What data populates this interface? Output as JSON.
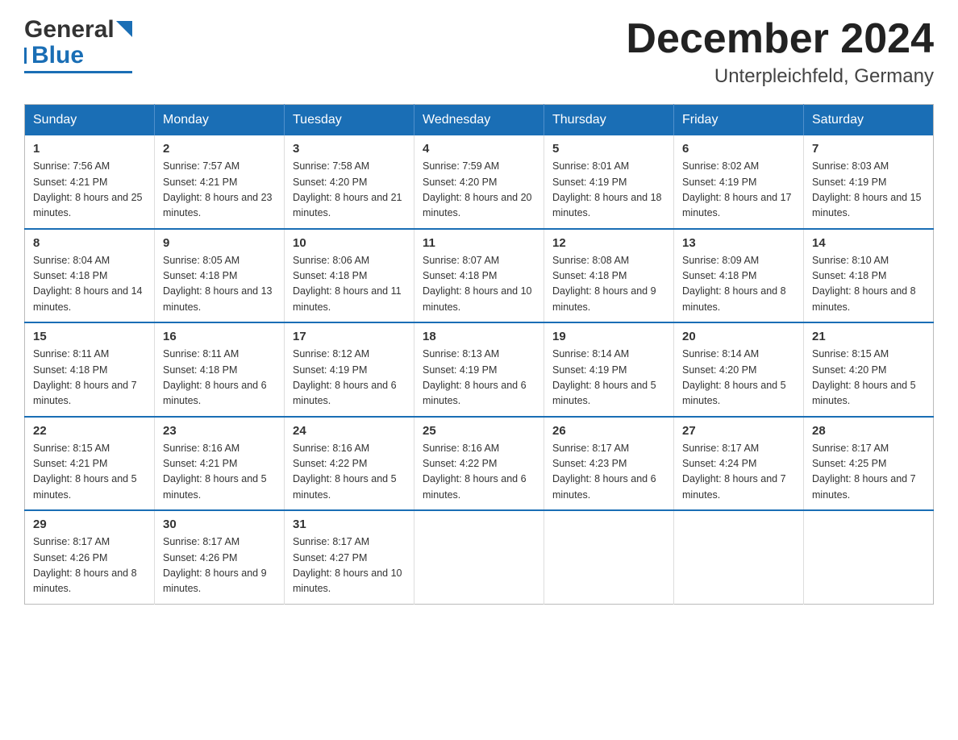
{
  "header": {
    "logo_text_general": "General",
    "logo_text_blue": "Blue",
    "month_title": "December 2024",
    "location": "Unterpleichfeld, Germany"
  },
  "weekdays": [
    "Sunday",
    "Monday",
    "Tuesday",
    "Wednesday",
    "Thursday",
    "Friday",
    "Saturday"
  ],
  "weeks": [
    [
      {
        "day": "1",
        "sunrise": "7:56 AM",
        "sunset": "4:21 PM",
        "daylight": "8 hours and 25 minutes."
      },
      {
        "day": "2",
        "sunrise": "7:57 AM",
        "sunset": "4:21 PM",
        "daylight": "8 hours and 23 minutes."
      },
      {
        "day": "3",
        "sunrise": "7:58 AM",
        "sunset": "4:20 PM",
        "daylight": "8 hours and 21 minutes."
      },
      {
        "day": "4",
        "sunrise": "7:59 AM",
        "sunset": "4:20 PM",
        "daylight": "8 hours and 20 minutes."
      },
      {
        "day": "5",
        "sunrise": "8:01 AM",
        "sunset": "4:19 PM",
        "daylight": "8 hours and 18 minutes."
      },
      {
        "day": "6",
        "sunrise": "8:02 AM",
        "sunset": "4:19 PM",
        "daylight": "8 hours and 17 minutes."
      },
      {
        "day": "7",
        "sunrise": "8:03 AM",
        "sunset": "4:19 PM",
        "daylight": "8 hours and 15 minutes."
      }
    ],
    [
      {
        "day": "8",
        "sunrise": "8:04 AM",
        "sunset": "4:18 PM",
        "daylight": "8 hours and 14 minutes."
      },
      {
        "day": "9",
        "sunrise": "8:05 AM",
        "sunset": "4:18 PM",
        "daylight": "8 hours and 13 minutes."
      },
      {
        "day": "10",
        "sunrise": "8:06 AM",
        "sunset": "4:18 PM",
        "daylight": "8 hours and 11 minutes."
      },
      {
        "day": "11",
        "sunrise": "8:07 AM",
        "sunset": "4:18 PM",
        "daylight": "8 hours and 10 minutes."
      },
      {
        "day": "12",
        "sunrise": "8:08 AM",
        "sunset": "4:18 PM",
        "daylight": "8 hours and 9 minutes."
      },
      {
        "day": "13",
        "sunrise": "8:09 AM",
        "sunset": "4:18 PM",
        "daylight": "8 hours and 8 minutes."
      },
      {
        "day": "14",
        "sunrise": "8:10 AM",
        "sunset": "4:18 PM",
        "daylight": "8 hours and 8 minutes."
      }
    ],
    [
      {
        "day": "15",
        "sunrise": "8:11 AM",
        "sunset": "4:18 PM",
        "daylight": "8 hours and 7 minutes."
      },
      {
        "day": "16",
        "sunrise": "8:11 AM",
        "sunset": "4:18 PM",
        "daylight": "8 hours and 6 minutes."
      },
      {
        "day": "17",
        "sunrise": "8:12 AM",
        "sunset": "4:19 PM",
        "daylight": "8 hours and 6 minutes."
      },
      {
        "day": "18",
        "sunrise": "8:13 AM",
        "sunset": "4:19 PM",
        "daylight": "8 hours and 6 minutes."
      },
      {
        "day": "19",
        "sunrise": "8:14 AM",
        "sunset": "4:19 PM",
        "daylight": "8 hours and 5 minutes."
      },
      {
        "day": "20",
        "sunrise": "8:14 AM",
        "sunset": "4:20 PM",
        "daylight": "8 hours and 5 minutes."
      },
      {
        "day": "21",
        "sunrise": "8:15 AM",
        "sunset": "4:20 PM",
        "daylight": "8 hours and 5 minutes."
      }
    ],
    [
      {
        "day": "22",
        "sunrise": "8:15 AM",
        "sunset": "4:21 PM",
        "daylight": "8 hours and 5 minutes."
      },
      {
        "day": "23",
        "sunrise": "8:16 AM",
        "sunset": "4:21 PM",
        "daylight": "8 hours and 5 minutes."
      },
      {
        "day": "24",
        "sunrise": "8:16 AM",
        "sunset": "4:22 PM",
        "daylight": "8 hours and 5 minutes."
      },
      {
        "day": "25",
        "sunrise": "8:16 AM",
        "sunset": "4:22 PM",
        "daylight": "8 hours and 6 minutes."
      },
      {
        "day": "26",
        "sunrise": "8:17 AM",
        "sunset": "4:23 PM",
        "daylight": "8 hours and 6 minutes."
      },
      {
        "day": "27",
        "sunrise": "8:17 AM",
        "sunset": "4:24 PM",
        "daylight": "8 hours and 7 minutes."
      },
      {
        "day": "28",
        "sunrise": "8:17 AM",
        "sunset": "4:25 PM",
        "daylight": "8 hours and 7 minutes."
      }
    ],
    [
      {
        "day": "29",
        "sunrise": "8:17 AM",
        "sunset": "4:26 PM",
        "daylight": "8 hours and 8 minutes."
      },
      {
        "day": "30",
        "sunrise": "8:17 AM",
        "sunset": "4:26 PM",
        "daylight": "8 hours and 9 minutes."
      },
      {
        "day": "31",
        "sunrise": "8:17 AM",
        "sunset": "4:27 PM",
        "daylight": "8 hours and 10 minutes."
      },
      null,
      null,
      null,
      null
    ]
  ]
}
